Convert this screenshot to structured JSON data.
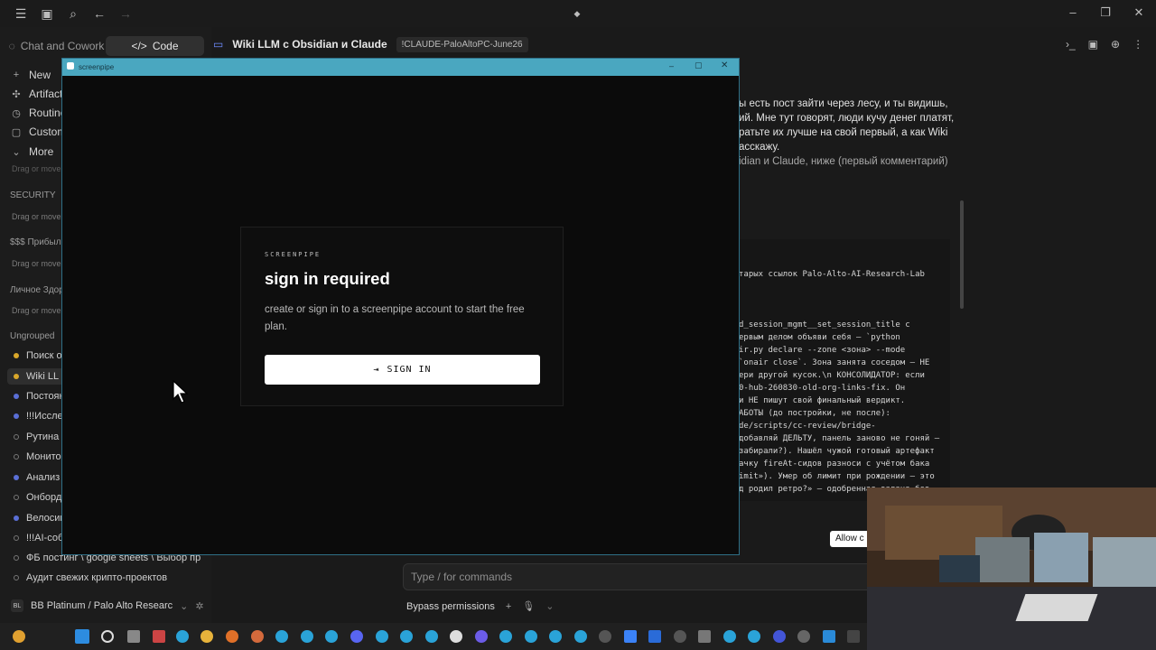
{
  "sidebar": {
    "modes": [
      {
        "label": "Chat and Cowork"
      },
      {
        "label": "Code"
      }
    ],
    "nav": [
      {
        "label": "New"
      },
      {
        "label": "Artifact"
      },
      {
        "label": "Routine"
      },
      {
        "label": "Custom"
      },
      {
        "label": "More"
      }
    ],
    "drag_hint": "Drag or move",
    "sections": [
      "SECURITY",
      "$$$ Прибыль",
      "Личное Здор"
    ],
    "ungrouped_label": "Ungrouped",
    "chats": [
      "Поиск о",
      "Wiki LL",
      "Постоян",
      "!!!Иссле",
      "Рутина в",
      "Монитор",
      "Анализ",
      "Онборд",
      "Велосип",
      "!!!AI-соб",
      "ФБ постинг \\ google sheets \\ Выбор пр",
      "Аудит свежих крипто-проектов"
    ],
    "workspace": {
      "initials": "BL",
      "name": "BB Platinum / Palo Alto Researc"
    }
  },
  "header": {
    "title": "Wiki LLM с Obsidian и Claude",
    "branch": "!CLAUDE-PaloAltoPC-June26"
  },
  "chat_text": [
    "ы есть пост зайти через лесу, и ты видишь,",
    "ий. Мне тут говорят, люди кучу денег платят,",
    "ратьте их лучше на свой первый, а как Wiki",
    "асскажу.",
    "idian и Claude, ниже (первый комментарий)"
  ],
  "code_lines": [
    "тарых ссылок Palo-Alto-AI-Research-Lab",
    "d_session_mgmt__set_session_title с",
    "ервым делом объяви себя — `python",
    "ir.py declare --zone <зона> --mode",
    "`onair close`. Зона занята соседом — НЕ",
    "ери другой кусок.\\n  КОНСОЛИДАТОР: если",
    "0-hub-260830-old-org-links-fix. Он",
    " и НЕ пишут свой финальный вердикт.",
    "АБОТЫ (до постройки, не после):",
    "de/scripts/cc-review/bridge-",
    "добавляй ДЕЛЬТУ, панель заново не гоняй —",
    "забирали?). Нашёл чужой готовый артефакт",
    "ачку fireAt-сидов разноси с учётом бака",
    "imit»). Умер об лимит при рождении — это",
    "д родил ретро?» — одобренная задача без"
  ],
  "screenpipe": {
    "window_title": "screenpipe",
    "brand": "SCREENPIPE",
    "heading": "sign in required",
    "description": "create or sign in to a screenpipe account to start the free plan.",
    "button_label": "SIGN IN"
  },
  "composer": {
    "placeholder": "Type / for commands"
  },
  "permissions": {
    "label": "Bypass permissions"
  },
  "allow_tooltip": "Allow c"
}
